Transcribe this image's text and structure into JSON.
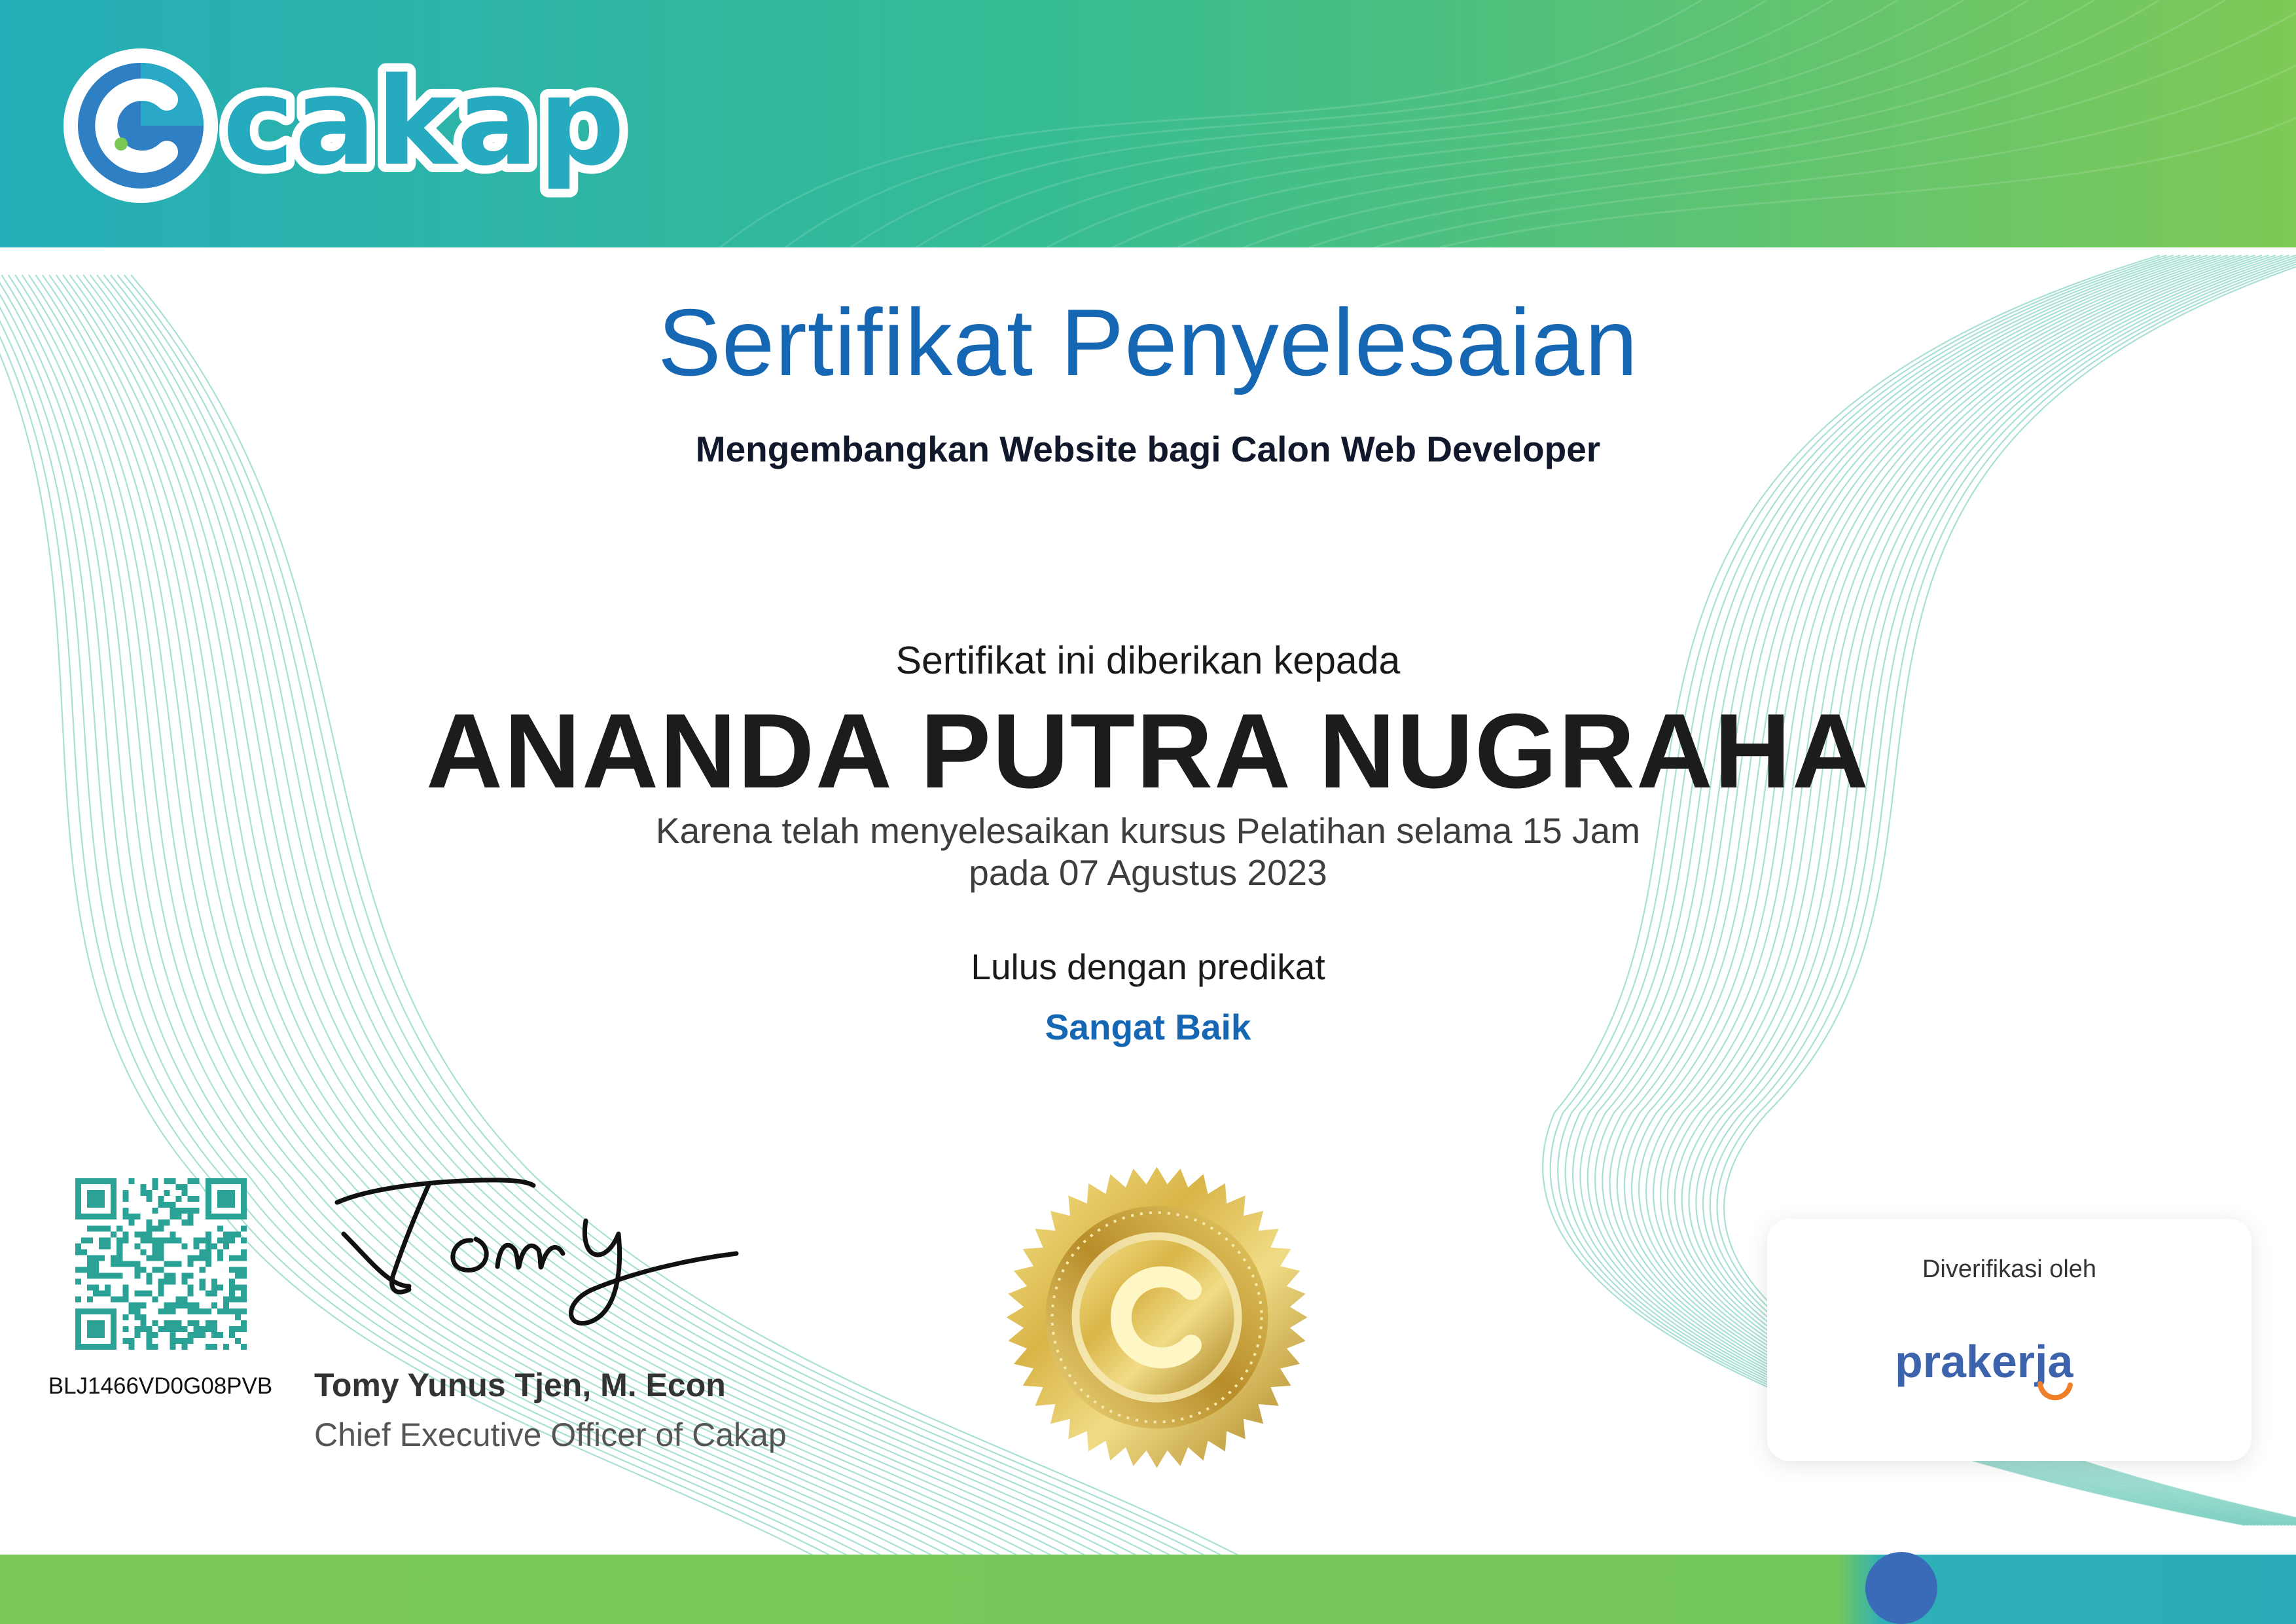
{
  "brand": {
    "name": "cakap",
    "colors": {
      "teal": "#24b1b6",
      "green": "#78c756",
      "blue": "#1566b3",
      "gold": "#c9a53a"
    }
  },
  "certificate": {
    "title": "Sertifikat Penyelesaian",
    "course": "Mengembangkan Website bagi Calon Web Developer",
    "given_to_label": "Sertifikat ini diberikan kepada",
    "recipient": "ANANDA PUTRA NUGRAHA",
    "reason_line_1": "Karena telah menyelesaikan kursus Pelatihan selama 15 Jam",
    "reason_line_2": "pada 07 Agustus 2023",
    "pass_label": "Lulus dengan predikat",
    "grade": "Sangat Baik"
  },
  "verification": {
    "certificate_id": "BLJ1466VD0G08PVB",
    "verified_by_label": "Diverifikasi oleh",
    "verifier": "prakerja"
  },
  "signatory": {
    "signature": "Tomy",
    "name": "Tomy Yunus Tjen, M. Econ",
    "role": "Chief Executive Officer of Cakap"
  },
  "icons": {
    "logo": "cakap-logo",
    "seal": "gold-seal-icon",
    "qr": "qr-code-icon",
    "verifier_logo": "prakerja-logo"
  }
}
